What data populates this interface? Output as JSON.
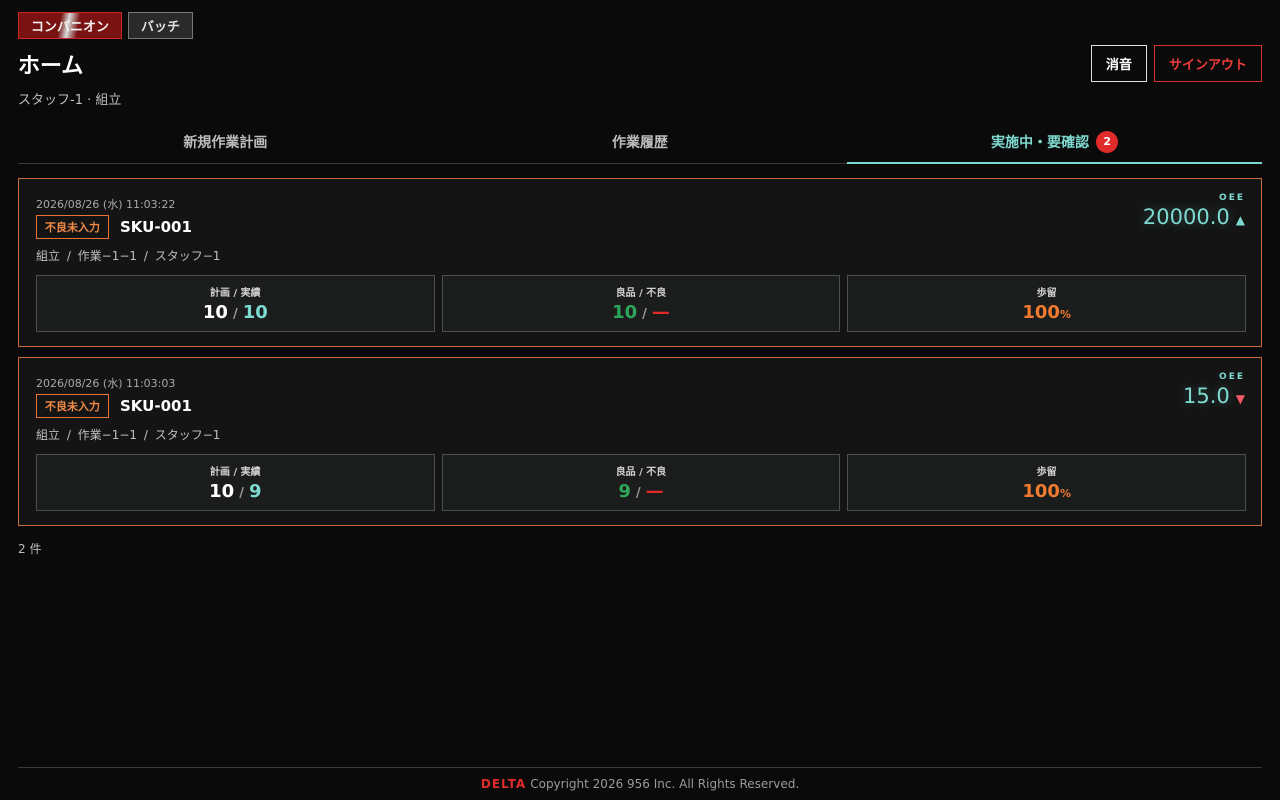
{
  "mode": {
    "companion_label": "コンパニオン",
    "batch_label": "バッチ"
  },
  "header": {
    "title": "ホーム",
    "subtitle": "スタッフ-1 · 組立",
    "mute_label": "消音",
    "signout_label": "サインアウト"
  },
  "tabs": [
    {
      "label": "新規作業計画"
    },
    {
      "label": "作業履歴"
    },
    {
      "label": "実施中・要確認",
      "badge": "2"
    }
  ],
  "cards": [
    {
      "timestamp": "2026/08/26 (水) 11:03:22",
      "tag": "不良未入力",
      "sku": "SKU-001",
      "path": "組立 / 作業−1−1 / スタッフ−1",
      "oee_label": "OEE",
      "oee_value": "20000.0",
      "oee_trend": "up",
      "oee_arrow": "▲",
      "plan_label": "計画 / 実績",
      "plan": "10",
      "actual": "10",
      "quality_label": "良品 / 不良",
      "good": "10",
      "defect": "—",
      "yield_label": "歩留",
      "yield": "100",
      "yield_unit": "%"
    },
    {
      "timestamp": "2026/08/26 (水) 11:03:03",
      "tag": "不良未入力",
      "sku": "SKU-001",
      "path": "組立 / 作業−1−1 / スタッフ−1",
      "oee_label": "OEE",
      "oee_value": "15.0",
      "oee_trend": "down",
      "oee_arrow": "▼",
      "plan_label": "計画 / 実績",
      "plan": "10",
      "actual": "9",
      "quality_label": "良品 / 不良",
      "good": "9",
      "defect": "—",
      "yield_label": "歩留",
      "yield": "100",
      "yield_unit": "%"
    }
  ],
  "list": {
    "count": "2 件"
  },
  "footer": {
    "brand": "DELTA",
    "copyright": "Copyright 2026 956 Inc. All Rights Reserved."
  },
  "colors": {
    "accent_teal": "#7ed9d0",
    "danger_red": "#e12b2b",
    "warning_orange": "#ef7a30",
    "good_green": "#2ea65a"
  }
}
